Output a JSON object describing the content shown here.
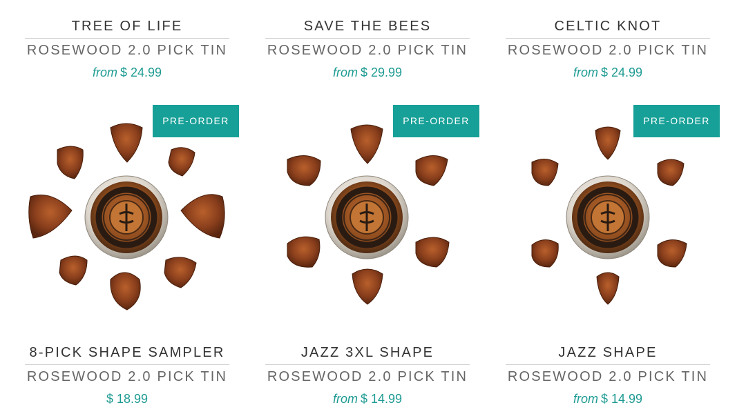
{
  "products_top": [
    {
      "title": "TREE OF LIFE",
      "subtitle": "ROSEWOOD 2.0 PICK TIN",
      "from_label": "from",
      "price": "$ 24.99"
    },
    {
      "title": "SAVE THE BEES",
      "subtitle": "ROSEWOOD 2.0 PICK TIN",
      "from_label": "from",
      "price": "$ 29.99"
    },
    {
      "title": "CELTIC KNOT",
      "subtitle": "ROSEWOOD 2.0 PICK TIN",
      "from_label": "from",
      "price": "$ 24.99"
    }
  ],
  "products_bottom": [
    {
      "title": "8-PICK SHAPE SAMPLER",
      "subtitle": "ROSEWOOD 2.0 PICK TIN",
      "from_label": "",
      "price": "$ 18.99",
      "badge": "PRE-ORDER"
    },
    {
      "title": "JAZZ 3XL SHAPE",
      "subtitle": "ROSEWOOD 2.0 PICK TIN",
      "from_label": "from",
      "price": "$ 14.99",
      "badge": "PRE-ORDER"
    },
    {
      "title": "JAZZ SHAPE",
      "subtitle": "ROSEWOOD 2.0 PICK TIN",
      "from_label": "from",
      "price": "$ 14.99",
      "badge": "PRE-ORDER"
    }
  ],
  "pick_logo": "thalia",
  "colors": {
    "accent": "#17a097",
    "price": "#1e9b93",
    "wood": "#8a3f1c",
    "tin_rim": "#d9d2c8"
  }
}
